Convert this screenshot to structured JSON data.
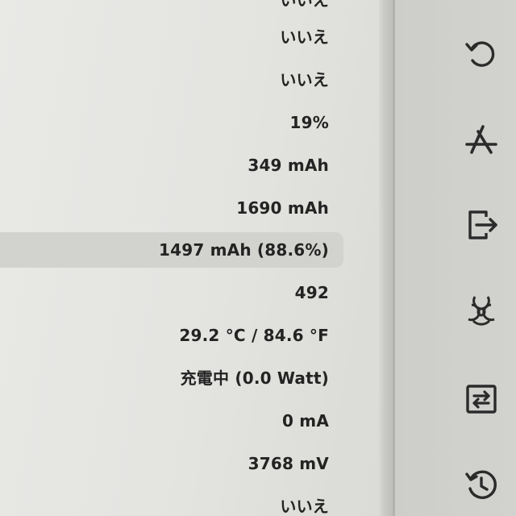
{
  "values": [
    {
      "text": "いいえ"
    },
    {
      "text": "いいえ"
    },
    {
      "text": "いいえ"
    },
    {
      "text": "19%"
    },
    {
      "text": "349 mAh"
    },
    {
      "text": "1690 mAh"
    },
    {
      "text": "1497 mAh (88.6%)"
    },
    {
      "text": "492"
    },
    {
      "text": "29.2 °C / 84.6 °F"
    },
    {
      "text": "充電中 (0.0 Watt)"
    },
    {
      "text": "0 mA"
    },
    {
      "text": "3768 mV"
    },
    {
      "text": "いいえ"
    }
  ],
  "toolbar": {
    "icons": [
      "refresh-icon",
      "app-store-icon",
      "exit-icon",
      "biohazard-icon",
      "switch-icon",
      "history-icon"
    ]
  },
  "colors": {
    "text": "#232323",
    "icon": "#2b2b2b",
    "highlight": "#d2d2ce"
  }
}
